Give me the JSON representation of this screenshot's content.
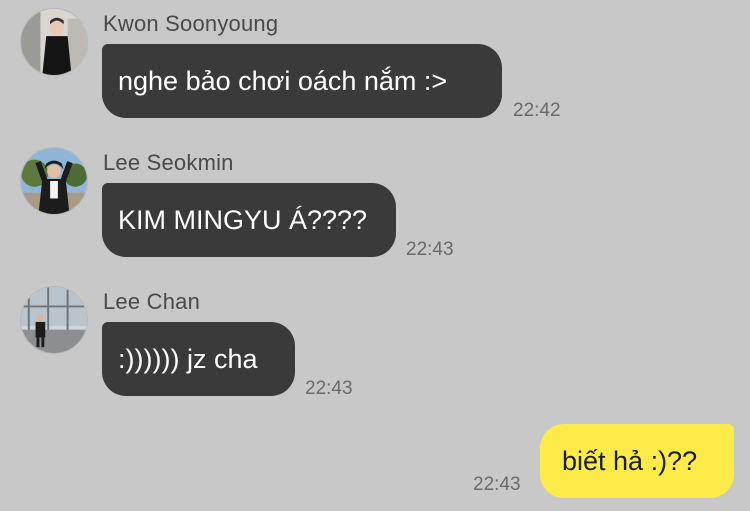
{
  "messages": [
    {
      "sender": "Kwon Soonyoung",
      "text": "nghe bảo chơi oách nắm :>",
      "time": "22:42",
      "avatar_icon": "avatar-photo-icon"
    },
    {
      "sender": "Lee Seokmin",
      "text": "KIM MINGYU Á????",
      "time": "22:43",
      "avatar_icon": "avatar-photo-icon"
    },
    {
      "sender": "Lee Chan",
      "text": ":)))))) jz cha",
      "time": "22:43",
      "avatar_icon": "avatar-photo-icon"
    },
    {
      "sender": "",
      "text": "biết hả :)??",
      "time": "22:43",
      "outgoing": true
    }
  ],
  "colors": {
    "background": "#c8c8c8",
    "incoming_bubble": "#3a3a3a",
    "outgoing_bubble": "#fdeb4a",
    "timestamp": "#6a6a6a",
    "sender_name": "#4a4a4a"
  }
}
